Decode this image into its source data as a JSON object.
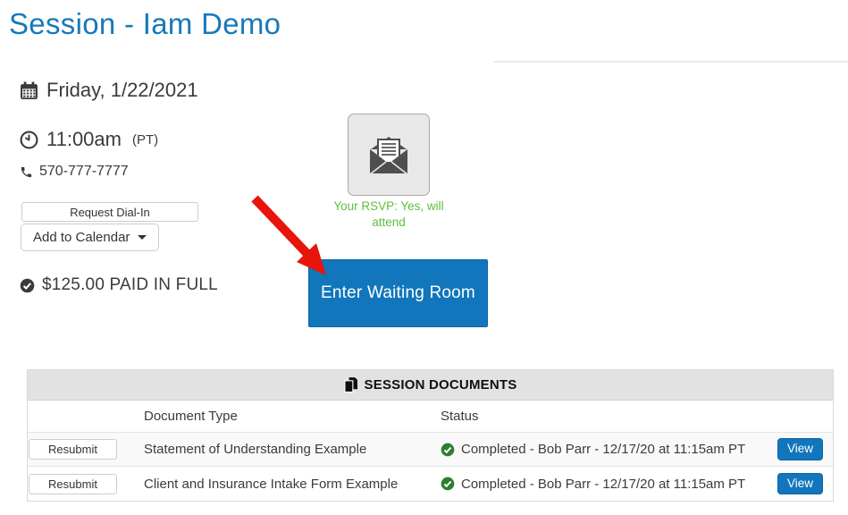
{
  "page": {
    "title": "Session - Iam Demo"
  },
  "session": {
    "date": "Friday, 1/22/2021",
    "time": "11:00am",
    "timezone": "(PT)",
    "phone": "570-777-7777",
    "request_dial_in_label": "Request Dial-In",
    "add_to_calendar_label": "Add to Calendar",
    "payment_status": "$125.00 PAID IN FULL",
    "rsvp_status": "Your RSVP: Yes, will attend",
    "enter_waiting_room_label": "Enter Waiting Room"
  },
  "documents": {
    "title": "SESSION DOCUMENTS",
    "columns": {
      "document_type": "Document Type",
      "status": "Status"
    },
    "rows": [
      {
        "action_label": "Resubmit",
        "document_type": "Statement of Understanding Example",
        "status": "Completed - Bob Parr - 12/17/20 at 11:15am PT",
        "view_label": "View"
      },
      {
        "action_label": "Resubmit",
        "document_type": "Client and Insurance Intake Form Example",
        "status": "Completed - Bob Parr - 12/17/20 at 11:15am PT",
        "view_label": "View"
      }
    ]
  },
  "colors": {
    "title_blue": "#1779ba",
    "button_blue": "#1276bc",
    "rsvp_green": "#5cbf3c",
    "completed_green": "#2e7d32",
    "arrow_red": "#e8150d"
  }
}
